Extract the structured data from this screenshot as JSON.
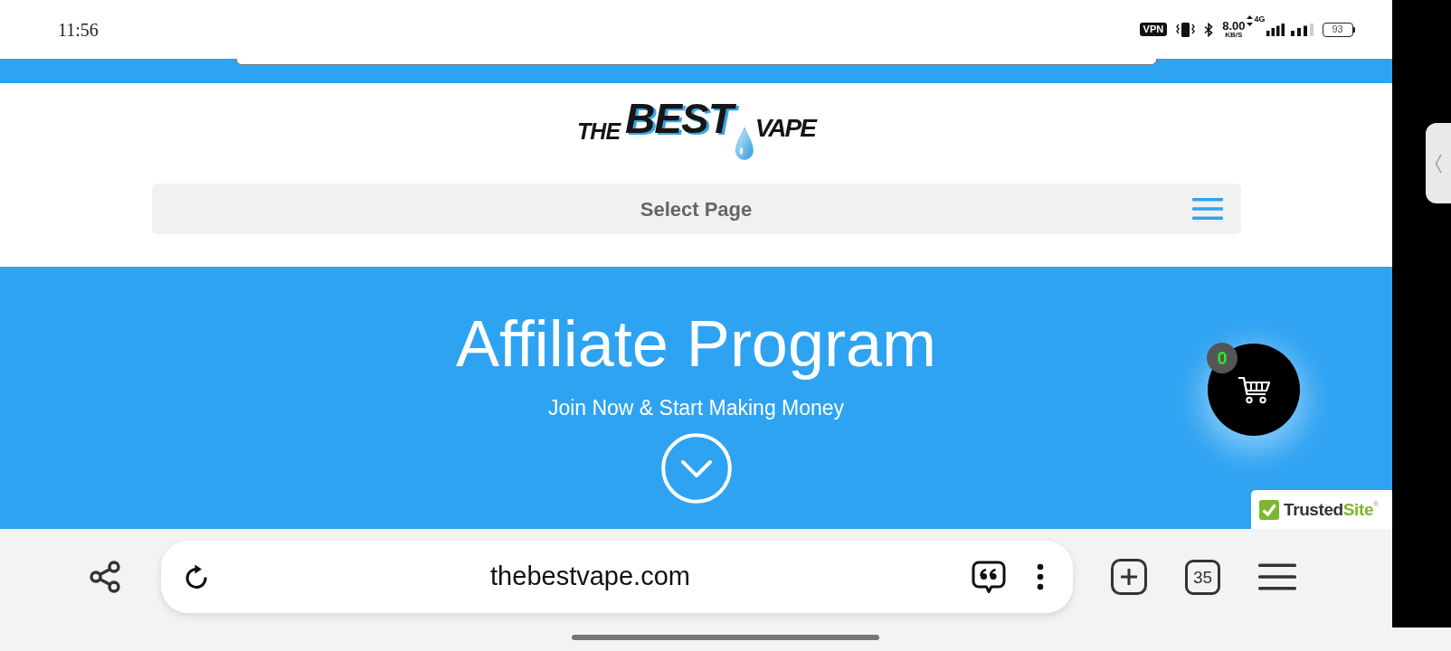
{
  "status_bar": {
    "time": "11:56",
    "vpn": "VPN",
    "speed": "8.00",
    "speed_unit": "KB/S",
    "network": "4G",
    "battery": "93"
  },
  "site": {
    "logo": {
      "words": [
        "THE",
        "BEST",
        "VAPE"
      ]
    },
    "menu": {
      "label": "Select Page"
    },
    "hero": {
      "title": "Affiliate Program",
      "subtitle": "Join Now & Start Making Money"
    },
    "cart": {
      "count": "0"
    },
    "trust_badge": {
      "parts": [
        {
          "text": "Trusted",
          "color": "#333333"
        },
        {
          "text": "Site$^{®}$",
          "color": "#7cb82f"
        }
      ]
    }
  },
  "browser": {
    "url": "thebestvape.com",
    "tab_count": "35"
  }
}
